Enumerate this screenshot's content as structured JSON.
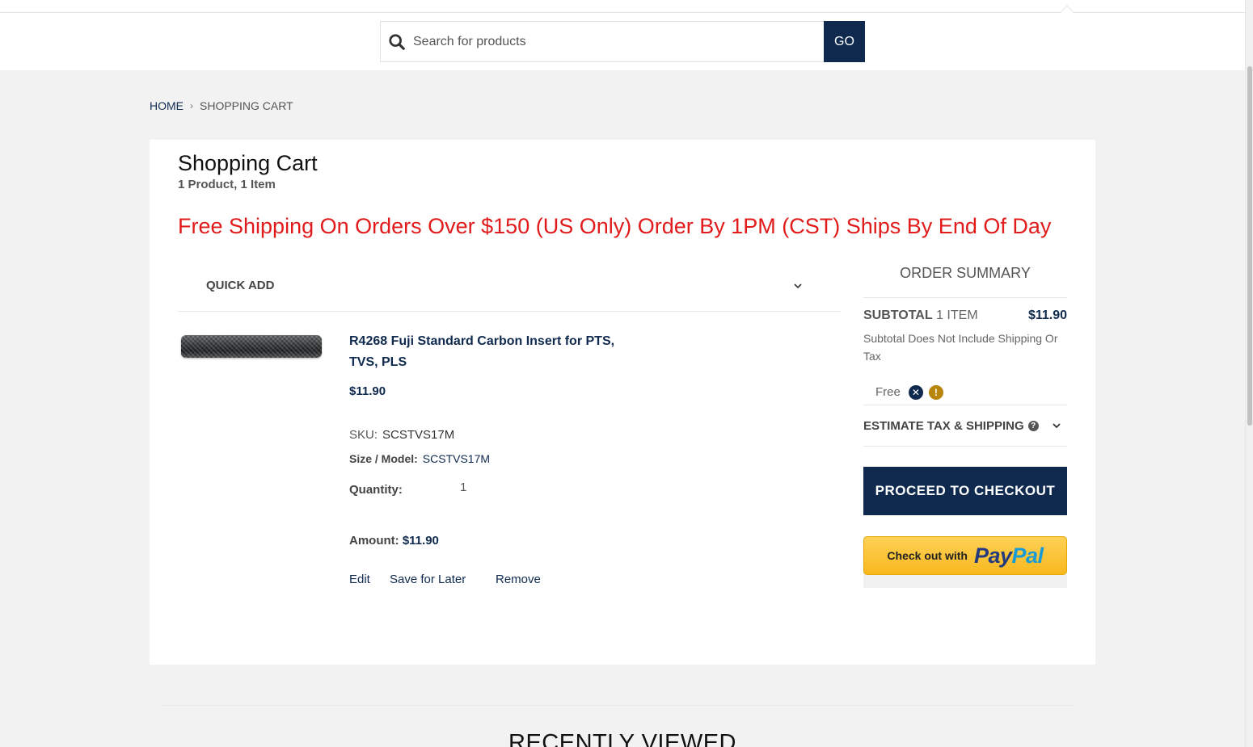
{
  "search": {
    "placeholder": "Search for products",
    "go_label": "GO"
  },
  "breadcrumb": {
    "home": "HOME",
    "current": "SHOPPING CART"
  },
  "cart": {
    "title": "Shopping Cart",
    "count": "1 Product, 1 Item",
    "promo": "Free Shipping On Orders Over $150 (US Only) Order By 1PM (CST) Ships By End Of Day",
    "quick_add_label": "QUICK ADD"
  },
  "item": {
    "name": "R4268 Fuji Standard Carbon Insert for PTS, TVS, PLS",
    "price": "$11.90",
    "sku_label": "SKU:",
    "sku": "SCSTVS17M",
    "size_label": "Size / Model:",
    "size": "SCSTVS17M",
    "quantity_label": "Quantity:",
    "quantity": "1",
    "amount_label": "Amount:",
    "amount": "$11.90",
    "actions": {
      "edit": "Edit",
      "save_for_later": "Save for Later",
      "remove": "Remove"
    }
  },
  "summary": {
    "title": "ORDER SUMMARY",
    "subtotal_label": "SUBTOTAL",
    "subtotal_items": "1 ITEM",
    "subtotal_amount": "$11.90",
    "subtotal_note": "Subtotal Does Not Include Shipping Or Tax",
    "shipping": "Free",
    "estimate_label": "ESTIMATE TAX & SHIPPING",
    "checkout_label": "PROCEED TO CHECKOUT",
    "paypal_text": "Check out with",
    "paypal_logo_pay": "Pay",
    "paypal_logo_pal": "Pal"
  },
  "recently_viewed": "RECENTLY VIEWED",
  "colors": {
    "navy": "#0f2a4e",
    "promo_red": "#e11b1b",
    "paypal_yellow": "#f7b81e"
  }
}
